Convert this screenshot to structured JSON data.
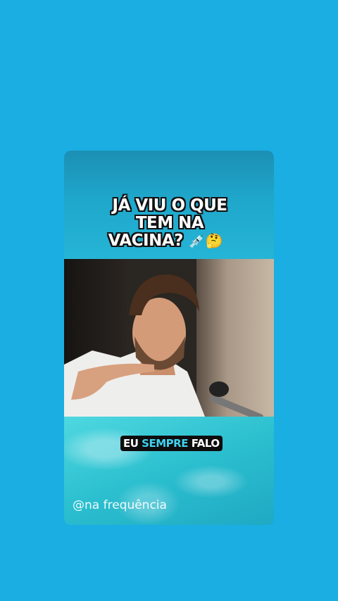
{
  "headline": {
    "line1": "JÁ VIU O QUE",
    "line2": "TEM NA",
    "line3": "VACINA?",
    "emojis": "💉🤔"
  },
  "caption": {
    "word1": "EU",
    "word2": "SEMPRE",
    "word3": "FALO"
  },
  "watermark": "@na frequência",
  "colors": {
    "background": "#1aaee3",
    "caption_highlight": "#3fd3f0"
  }
}
